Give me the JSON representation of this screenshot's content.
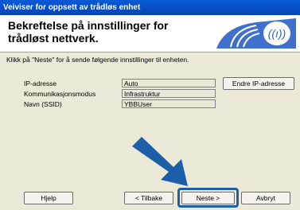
{
  "window": {
    "title": "Veiviser for oppsett av trådløs enhet"
  },
  "header": {
    "title": "Bekreftelse på innstillinger for trådløst nettverk."
  },
  "instruction": "Klikk på \"Neste\" for å sende følgende innstillinger til enheten.",
  "fields": [
    {
      "label": "IP-adresse",
      "value": "Auto"
    },
    {
      "label": "Kommunikasjonsmodus",
      "value": "Infrastruktur"
    },
    {
      "label": "Navn (SSID)",
      "value": "YBBUser"
    }
  ],
  "buttons": {
    "change_ip": "Endre IP-adresse",
    "help": "Hjelp",
    "back": "< Tilbake",
    "next": "Neste >",
    "cancel": "Avbryt"
  },
  "colors": {
    "accent": "#1d5ea8",
    "titlebar": "#0a5ad6"
  },
  "icons": {
    "logo": "wifi-logo-icon",
    "arrow": "pointer-arrow-icon"
  }
}
